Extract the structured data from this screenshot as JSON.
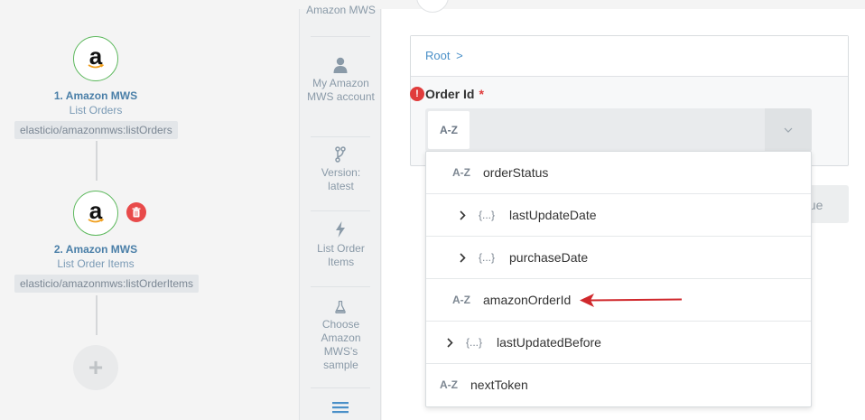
{
  "flow": {
    "nodes": [
      {
        "title": "1. Amazon MWS",
        "subtitle": "List Orders",
        "tag": "elasticio/amazonmws:listOrders",
        "icon": "amazon-logo-icon"
      },
      {
        "title": "2. Amazon MWS",
        "subtitle": "List Order Items",
        "tag": "elasticio/amazonmws:listOrderItems",
        "icon": "amazon-logo-icon"
      }
    ],
    "add_label": "+",
    "logo_letter": "a"
  },
  "steps": [
    {
      "label": "Amazon MWS"
    },
    {
      "label": "My Amazon MWS account",
      "icon": "user-icon"
    },
    {
      "label": "Version: latest",
      "icon": "branch-icon"
    },
    {
      "label": "List Order Items",
      "icon": "lightning-icon"
    },
    {
      "label": "Choose Amazon MWS's sample",
      "icon": "flask-icon"
    },
    {
      "label": "",
      "icon": "menu-icon"
    }
  ],
  "mapper": {
    "breadcrumb": "Root",
    "breadcrumb_sep": ">",
    "field": {
      "label": "Order Id",
      "required_mark": "*",
      "type": "A-Z",
      "value": ""
    },
    "error_icon": "!"
  },
  "continue_label": "nue",
  "dropdown": {
    "items": [
      {
        "type": "A-Z",
        "label": "orderStatus",
        "expandable": false
      },
      {
        "type": "{...}",
        "label": "lastUpdateDate",
        "expandable": true
      },
      {
        "type": "{...}",
        "label": "purchaseDate",
        "expandable": true
      },
      {
        "type": "A-Z",
        "label": "amazonOrderId",
        "expandable": false
      },
      {
        "type": "{...}",
        "label": "lastUpdatedBefore",
        "expandable": true
      },
      {
        "type": "A-Z",
        "label": "nextToken",
        "expandable": false
      }
    ]
  },
  "colors": {
    "node_border": "#5cb85c",
    "link": "#4a90c8",
    "required": "#e03c3c",
    "arrow": "#d0282c",
    "delete": "#e84a4a"
  }
}
